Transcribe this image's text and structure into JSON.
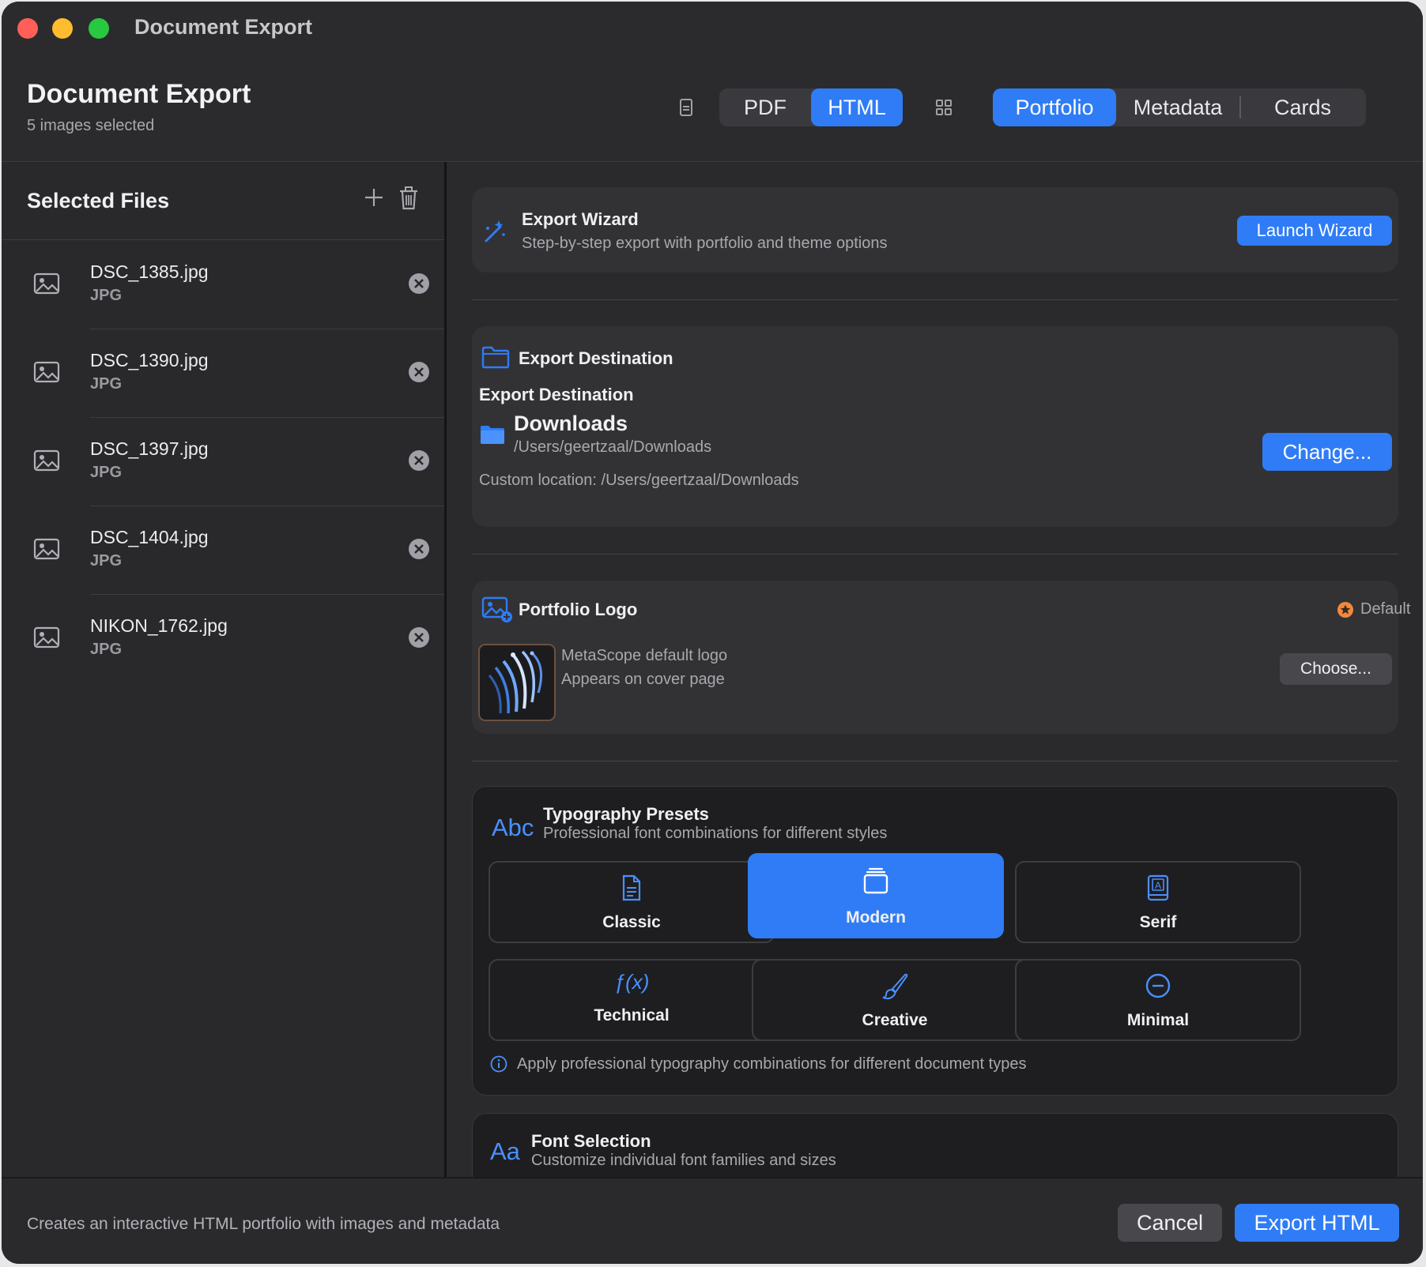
{
  "window": {
    "title": "Document Export"
  },
  "header": {
    "title": "Document Export",
    "subtitle": "5 images selected",
    "format_tabs": [
      {
        "label": "PDF",
        "selected": false
      },
      {
        "label": "HTML",
        "selected": true
      }
    ],
    "view_tabs": [
      {
        "label": "Portfolio",
        "selected": true
      },
      {
        "label": "Metadata",
        "selected": false
      },
      {
        "label": "Cards",
        "selected": false
      }
    ],
    "icons": {
      "format": "document-icon",
      "view": "grid-icon"
    }
  },
  "sidebar": {
    "title": "Selected Files",
    "files": [
      {
        "name": "DSC_1385.jpg",
        "type": "JPG"
      },
      {
        "name": "DSC_1390.jpg",
        "type": "JPG"
      },
      {
        "name": "DSC_1397.jpg",
        "type": "JPG"
      },
      {
        "name": "DSC_1404.jpg",
        "type": "JPG"
      },
      {
        "name": "NIKON_1762.jpg",
        "type": "JPG"
      }
    ]
  },
  "wizard": {
    "title": "Export Wizard",
    "subtitle": "Step-by-step export with portfolio and theme options",
    "button": "Launch Wizard"
  },
  "destination": {
    "section_title": "Export Destination",
    "label": "Export Destination",
    "folder": "Downloads",
    "path": "/Users/geertzaal/Downloads",
    "button": "Change...",
    "custom": "Custom location: /Users/geertzaal/Downloads"
  },
  "logo": {
    "title": "Portfolio Logo",
    "badge": "Default",
    "line1": "MetaScope default logo",
    "line2": "Appears on cover page",
    "button": "Choose..."
  },
  "typography": {
    "icon_text": "Abc",
    "title": "Typography Presets",
    "subtitle": "Professional font combinations for different styles",
    "presets": [
      {
        "label": "Classic",
        "selected": false,
        "icon": "document-icon"
      },
      {
        "label": "Modern",
        "selected": true,
        "icon": "stack-icon"
      },
      {
        "label": "Serif",
        "selected": false,
        "icon": "book-icon"
      },
      {
        "label": "Technical",
        "selected": false,
        "icon": "function-icon",
        "icon_text": "ƒ(x)"
      },
      {
        "label": "Creative",
        "selected": false,
        "icon": "paintbrush-icon"
      },
      {
        "label": "Minimal",
        "selected": false,
        "icon": "minus-circle-icon"
      }
    ],
    "info": "Apply professional typography combinations for different document types"
  },
  "fonts": {
    "icon_text": "Aa",
    "title": "Font Selection",
    "subtitle": "Customize individual font families and sizes"
  },
  "footer": {
    "description": "Creates an interactive HTML portfolio with images and metadata",
    "cancel": "Cancel",
    "export": "Export HTML"
  },
  "colors": {
    "accent": "#2f7cf6",
    "background": "#2a2a2d",
    "card": "#323235",
    "badge": "#f0883e"
  }
}
